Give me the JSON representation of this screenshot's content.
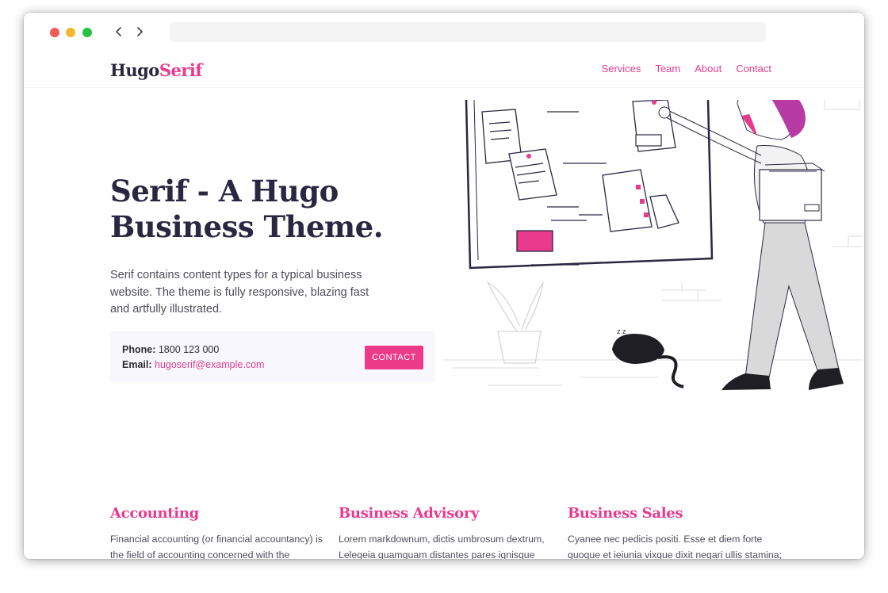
{
  "site": {
    "logo_part1": "Hugo",
    "logo_part2": "Serif",
    "nav": [
      "Services",
      "Team",
      "About",
      "Contact"
    ]
  },
  "hero": {
    "title_line1": "Serif - A Hugo",
    "title_line2": "Business Theme.",
    "description": "Serif contains content types for a typical business website. The theme is fully responsive, blazing fast and artfully illustrated."
  },
  "contact": {
    "phone_label": "Phone:",
    "phone_value": "1800 123 000",
    "email_label": "Email:",
    "email_value": "hugoserif@example.com",
    "button_label": "CONTACT"
  },
  "features": [
    {
      "title": "Accounting",
      "text": "Financial accounting (or financial accountancy) is the field of accounting concerned with the summary, analysis and"
    },
    {
      "title": "Business Advisory",
      "text": "Lorem markdownum, dictis umbrosum dextrum, Lelegeia quamquam distantes pares ignisque quaerit dederat gemino"
    },
    {
      "title": "Business Sales",
      "text": "Cyanee nec pedicis positi. Esse et diem forte quoque et ieiunia vixque dixit negari ullis stamina; trahit. Tanta rictus"
    }
  ],
  "colors": {
    "accent": "#e93a8d",
    "dark": "#2a2840",
    "contact_bg": "#f8f7fd"
  },
  "icons": {
    "back": "chevron-left-icon",
    "forward": "chevron-right-icon"
  }
}
